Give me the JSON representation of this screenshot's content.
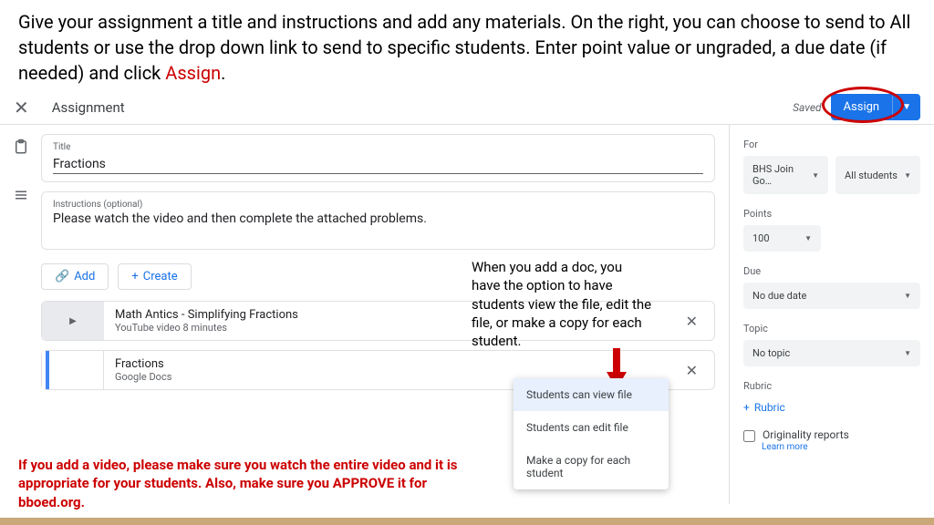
{
  "instructions": {
    "main": "Give your assignment a title and instructions and add any materials. On the right, you can choose to send to All students or use the drop down link to send to specific students.  Enter point value or ungraded, a due date (if needed) and click ",
    "assign_word": "Assign",
    "period": "."
  },
  "header": {
    "title": "Assignment",
    "saved": "Saved",
    "assign_btn": "Assign"
  },
  "fields": {
    "title_label": "Title",
    "title_value": "Fractions",
    "instructions_label": "Instructions (optional)",
    "instructions_value": "Please watch the video and then complete the attached problems."
  },
  "buttons": {
    "add": "Add",
    "create": "Create"
  },
  "attachments": [
    {
      "title": "Math Antics - Simplifying Fractions",
      "sub": "YouTube video   8 minutes"
    },
    {
      "title": "Fractions",
      "sub": "Google Docs"
    }
  ],
  "permissions": {
    "view": "Students can view file",
    "edit": "Students can edit file",
    "copy": "Make a copy for each student"
  },
  "sidebar": {
    "for_label": "For",
    "class_value": "BHS Join Go…",
    "students_value": "All students",
    "points_label": "Points",
    "points_value": "100",
    "due_label": "Due",
    "due_value": "No due date",
    "topic_label": "Topic",
    "topic_value": "No topic",
    "rubric_label": "Rubric",
    "rubric_btn": "Rubric",
    "originality": "Originality reports",
    "learn_more": "Learn more"
  },
  "annotations": {
    "doc_option": "When you add a doc, you have the option to have students view the file, edit the file, or make a copy for each student.",
    "video_note": "If you add a video, please make sure you watch the entire video and it is appropriate for your students.  Also, make sure you APPROVE it for bboed.org."
  }
}
